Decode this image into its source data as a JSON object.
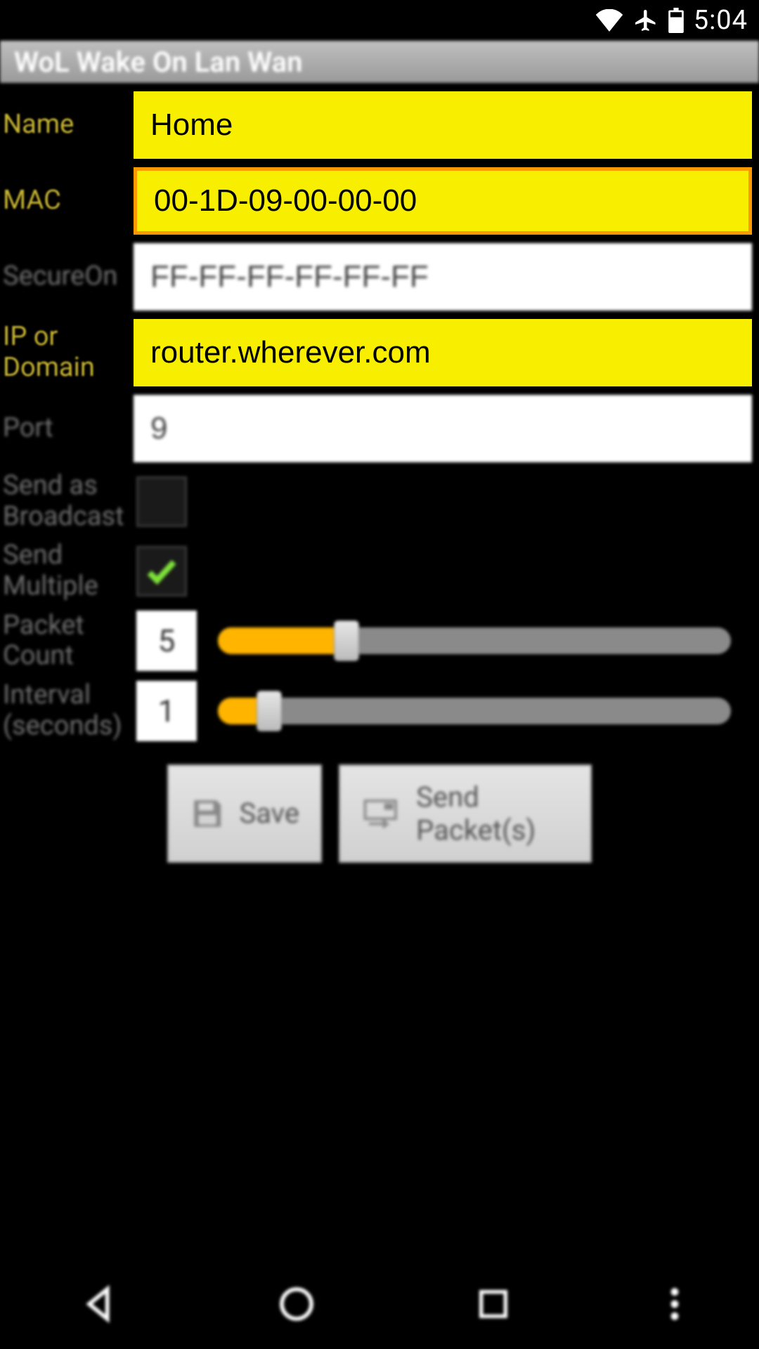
{
  "status": {
    "time": "5:04"
  },
  "title": "WoL Wake On Lan Wan",
  "form": {
    "name": {
      "label": "Name",
      "value": "Home"
    },
    "mac": {
      "label": "MAC",
      "value": "00-1D-09-00-00-00"
    },
    "secureon": {
      "label": "SecureOn",
      "value": "FF-FF-FF-FF-FF-FF"
    },
    "ip": {
      "label": "IP or Domain",
      "value": "router.wherever.com"
    },
    "port": {
      "label": "Port",
      "value": "9"
    },
    "broadcast": {
      "label": "Send as Broadcast",
      "checked": false
    },
    "multiple": {
      "label": "Send Multiple",
      "checked": true
    },
    "packet_count": {
      "label": "Packet Count",
      "value": "5",
      "slider_percent": 25
    },
    "interval": {
      "label": "Interval (seconds)",
      "value": "1",
      "slider_percent": 10
    }
  },
  "buttons": {
    "save": "Save",
    "send": "Send Packet(s)"
  }
}
